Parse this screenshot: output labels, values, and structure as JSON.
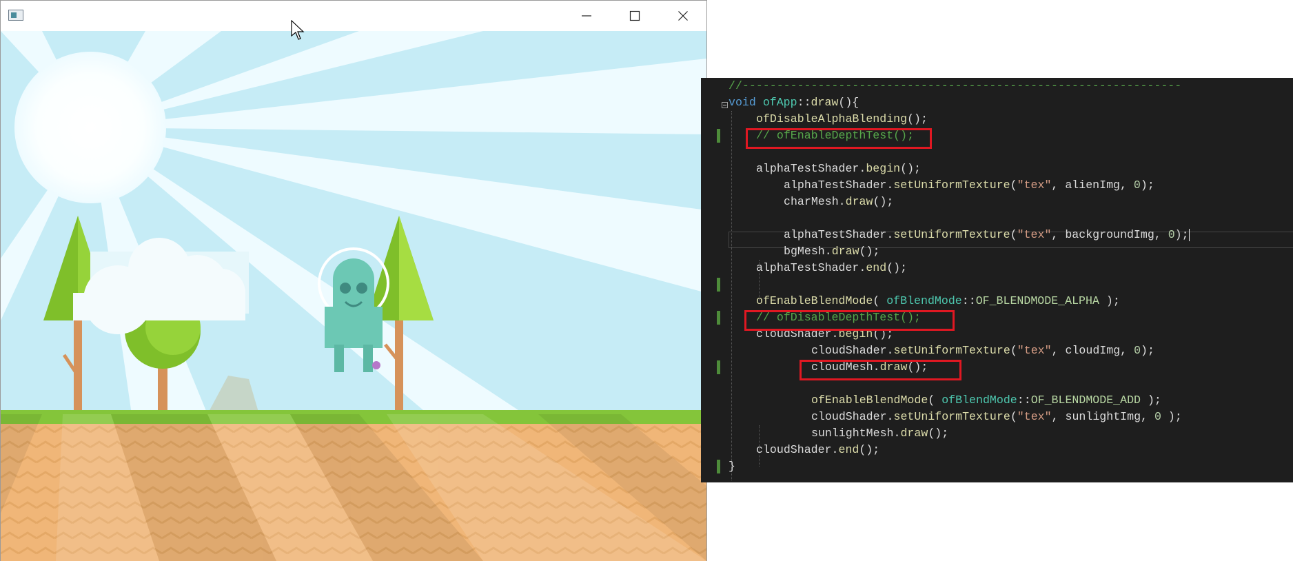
{
  "window": {
    "title": "",
    "controls": {
      "minimize": "minimize-icon",
      "maximize": "maximize-icon",
      "close": "close-icon"
    }
  },
  "scene": {
    "description_colors": {
      "sky": "#c6ecf6",
      "grass": "#84c53a",
      "dirt": "#f0b678",
      "alien": "#6cc8b4"
    }
  },
  "code": {
    "lines": [
      {
        "indent": 0,
        "tokens": [
          {
            "t": "//----------------------------------------------------------------",
            "c": "com"
          }
        ]
      },
      {
        "indent": 0,
        "tokens": [
          {
            "t": "void",
            "c": "kw"
          },
          {
            "t": " ",
            "c": "var"
          },
          {
            "t": "ofApp",
            "c": "cls"
          },
          {
            "t": "::",
            "c": "var"
          },
          {
            "t": "draw",
            "c": "fn"
          },
          {
            "t": "(){",
            "c": "var"
          }
        ]
      },
      {
        "indent": 4,
        "tokens": [
          {
            "t": "ofDisableAlphaBlending",
            "c": "fn"
          },
          {
            "t": "();",
            "c": "var"
          }
        ]
      },
      {
        "indent": 4,
        "tokens": [
          {
            "t": "// ofEnableDepthTest();",
            "c": "com"
          }
        ]
      },
      {
        "indent": 0,
        "tokens": []
      },
      {
        "indent": 4,
        "tokens": [
          {
            "t": "alphaTestShader",
            "c": "var"
          },
          {
            "t": ".",
            "c": "var"
          },
          {
            "t": "begin",
            "c": "fn"
          },
          {
            "t": "();",
            "c": "var"
          }
        ]
      },
      {
        "indent": 8,
        "tokens": [
          {
            "t": "alphaTestShader",
            "c": "var"
          },
          {
            "t": ".",
            "c": "var"
          },
          {
            "t": "setUniformTexture",
            "c": "fn"
          },
          {
            "t": "(",
            "c": "var"
          },
          {
            "t": "\"tex\"",
            "c": "str"
          },
          {
            "t": ", alienImg, ",
            "c": "var"
          },
          {
            "t": "0",
            "c": "num"
          },
          {
            "t": ");",
            "c": "var"
          }
        ]
      },
      {
        "indent": 8,
        "tokens": [
          {
            "t": "charMesh",
            "c": "var"
          },
          {
            "t": ".",
            "c": "var"
          },
          {
            "t": "draw",
            "c": "fn"
          },
          {
            "t": "();",
            "c": "var"
          }
        ]
      },
      {
        "indent": 0,
        "tokens": []
      },
      {
        "indent": 8,
        "caret": true,
        "tokens": [
          {
            "t": "alphaTestShader",
            "c": "var"
          },
          {
            "t": ".",
            "c": "var"
          },
          {
            "t": "setUniformTexture",
            "c": "fn"
          },
          {
            "t": "(",
            "c": "var"
          },
          {
            "t": "\"tex\"",
            "c": "str"
          },
          {
            "t": ", backgroundImg, ",
            "c": "var"
          },
          {
            "t": "0",
            "c": "num"
          },
          {
            "t": ");",
            "c": "var"
          }
        ]
      },
      {
        "indent": 8,
        "tokens": [
          {
            "t": "bgMesh",
            "c": "var"
          },
          {
            "t": ".",
            "c": "var"
          },
          {
            "t": "draw",
            "c": "fn"
          },
          {
            "t": "();",
            "c": "var"
          }
        ]
      },
      {
        "indent": 4,
        "tokens": [
          {
            "t": "alphaTestShader",
            "c": "var"
          },
          {
            "t": ".",
            "c": "var"
          },
          {
            "t": "end",
            "c": "fn"
          },
          {
            "t": "();",
            "c": "var"
          }
        ]
      },
      {
        "indent": 0,
        "tokens": []
      },
      {
        "indent": 4,
        "tokens": [
          {
            "t": "ofEnableBlendMode",
            "c": "fn"
          },
          {
            "t": "( ",
            "c": "var"
          },
          {
            "t": "ofBlendMode",
            "c": "cls"
          },
          {
            "t": "::",
            "c": "var"
          },
          {
            "t": "OF_BLENDMODE_ALPHA",
            "c": "enum"
          },
          {
            "t": " );",
            "c": "var"
          }
        ]
      },
      {
        "indent": 4,
        "tokens": [
          {
            "t": "// ofDisableDepthTest();",
            "c": "com"
          }
        ]
      },
      {
        "indent": 4,
        "tokens": [
          {
            "t": "cloudShader",
            "c": "var"
          },
          {
            "t": ".",
            "c": "var"
          },
          {
            "t": "begin",
            "c": "fn"
          },
          {
            "t": "();",
            "c": "var"
          }
        ]
      },
      {
        "indent": 12,
        "tokens": [
          {
            "t": "cloudShader",
            "c": "var"
          },
          {
            "t": ".",
            "c": "var"
          },
          {
            "t": "setUniformTexture",
            "c": "fn"
          },
          {
            "t": "(",
            "c": "var"
          },
          {
            "t": "\"tex\"",
            "c": "str"
          },
          {
            "t": ", cloudImg, ",
            "c": "var"
          },
          {
            "t": "0",
            "c": "num"
          },
          {
            "t": ");",
            "c": "var"
          }
        ]
      },
      {
        "indent": 12,
        "tokens": [
          {
            "t": "cloudMesh",
            "c": "var"
          },
          {
            "t": ".",
            "c": "var"
          },
          {
            "t": "draw",
            "c": "fn"
          },
          {
            "t": "();",
            "c": "var"
          }
        ]
      },
      {
        "indent": 0,
        "tokens": []
      },
      {
        "indent": 12,
        "tokens": [
          {
            "t": "ofEnableBlendMode",
            "c": "fn"
          },
          {
            "t": "( ",
            "c": "var"
          },
          {
            "t": "ofBlendMode",
            "c": "cls"
          },
          {
            "t": "::",
            "c": "var"
          },
          {
            "t": "OF_BLENDMODE_ADD",
            "c": "enum"
          },
          {
            "t": " );",
            "c": "var"
          }
        ]
      },
      {
        "indent": 12,
        "tokens": [
          {
            "t": "cloudShader",
            "c": "var"
          },
          {
            "t": ".",
            "c": "var"
          },
          {
            "t": "setUniformTexture",
            "c": "fn"
          },
          {
            "t": "(",
            "c": "var"
          },
          {
            "t": "\"tex\"",
            "c": "str"
          },
          {
            "t": ", sunlightImg, ",
            "c": "var"
          },
          {
            "t": "0",
            "c": "num"
          },
          {
            "t": " );",
            "c": "var"
          }
        ]
      },
      {
        "indent": 12,
        "tokens": [
          {
            "t": "sunlightMesh",
            "c": "var"
          },
          {
            "t": ".",
            "c": "var"
          },
          {
            "t": "draw",
            "c": "fn"
          },
          {
            "t": "();",
            "c": "var"
          }
        ]
      },
      {
        "indent": 4,
        "tokens": [
          {
            "t": "cloudShader",
            "c": "var"
          },
          {
            "t": ".",
            "c": "var"
          },
          {
            "t": "end",
            "c": "fn"
          },
          {
            "t": "();",
            "c": "var"
          }
        ]
      },
      {
        "indent": 0,
        "tokens": [
          {
            "t": "}",
            "c": "var"
          }
        ]
      }
    ],
    "modified_line_markers": [
      3,
      12,
      14,
      17,
      23
    ],
    "highlight_color": "#e01822",
    "highlighted_lines": [
      3,
      14,
      17
    ]
  }
}
